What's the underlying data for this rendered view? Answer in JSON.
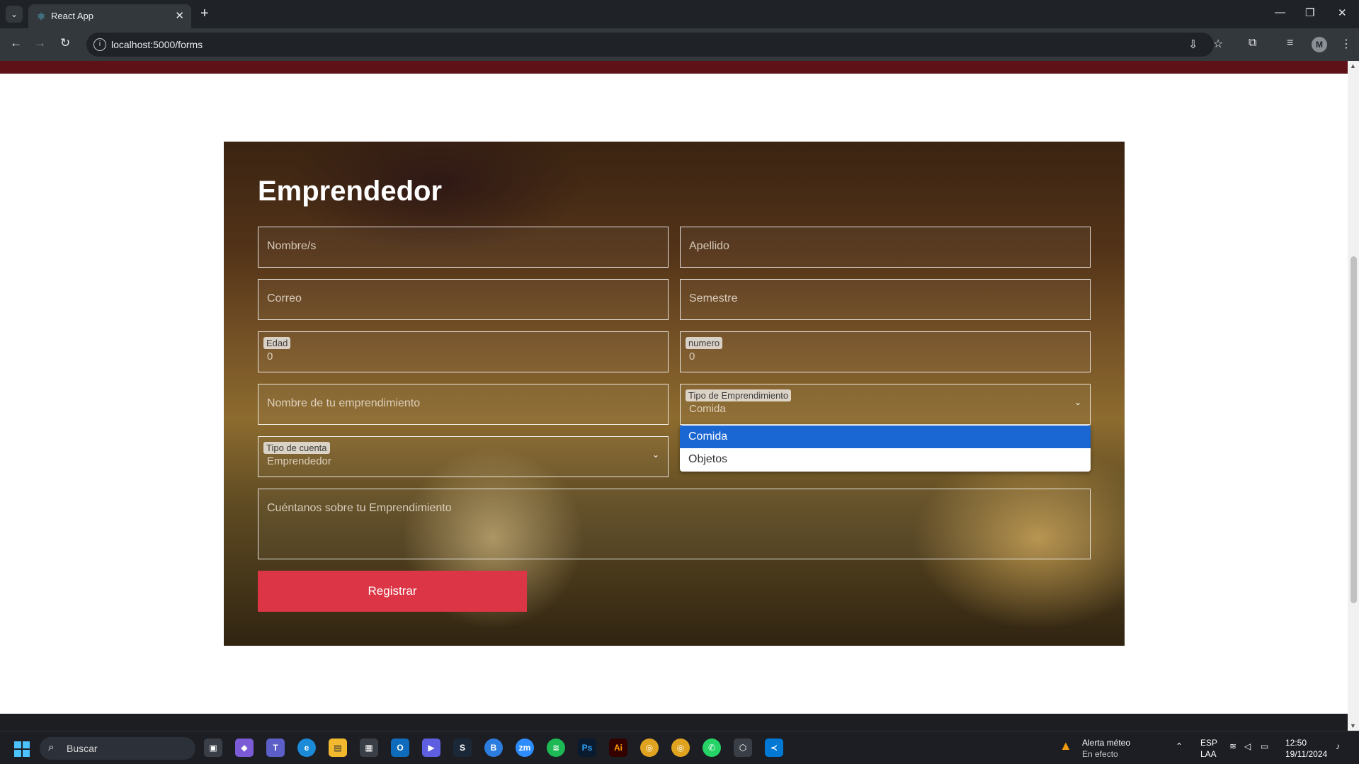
{
  "browser": {
    "tab_title": "React App",
    "url": "localhost:5000/forms"
  },
  "form": {
    "title": "Emprendedor",
    "fields": {
      "nombres_placeholder": "Nombre/s",
      "apellido_placeholder": "Apellido",
      "correo_placeholder": "Correo",
      "semestre_placeholder": "Semestre",
      "edad_label": "Edad",
      "edad_value": "0",
      "numero_label": "numero",
      "numero_value": "0",
      "emprendimiento_placeholder": "Nombre de tu emprendimiento",
      "tipo_emprendimiento_label": "Tipo de Emprendimiento",
      "tipo_emprendimiento_value": "Comida",
      "tipo_cuenta_label": "Tipo de cuenta",
      "tipo_cuenta_value": "Emprendedor",
      "descripcion_placeholder": "Cuéntanos sobre tu Emprendimiento"
    },
    "dropdown_options": [
      "Comida",
      "Objetos"
    ],
    "submit_label": "Registrar"
  },
  "taskbar": {
    "search_text": "Buscar",
    "weather_title": "Alerta méteo",
    "weather_sub": "En efecto",
    "lang_top": "ESP",
    "lang_bottom": "LAA",
    "time": "12:50",
    "date": "19/11/2024",
    "profile_initial": "M"
  },
  "colors": {
    "accent_button": "#dc3545",
    "dropdown_selected": "#1a66d2",
    "header_band": "#5e1217"
  }
}
